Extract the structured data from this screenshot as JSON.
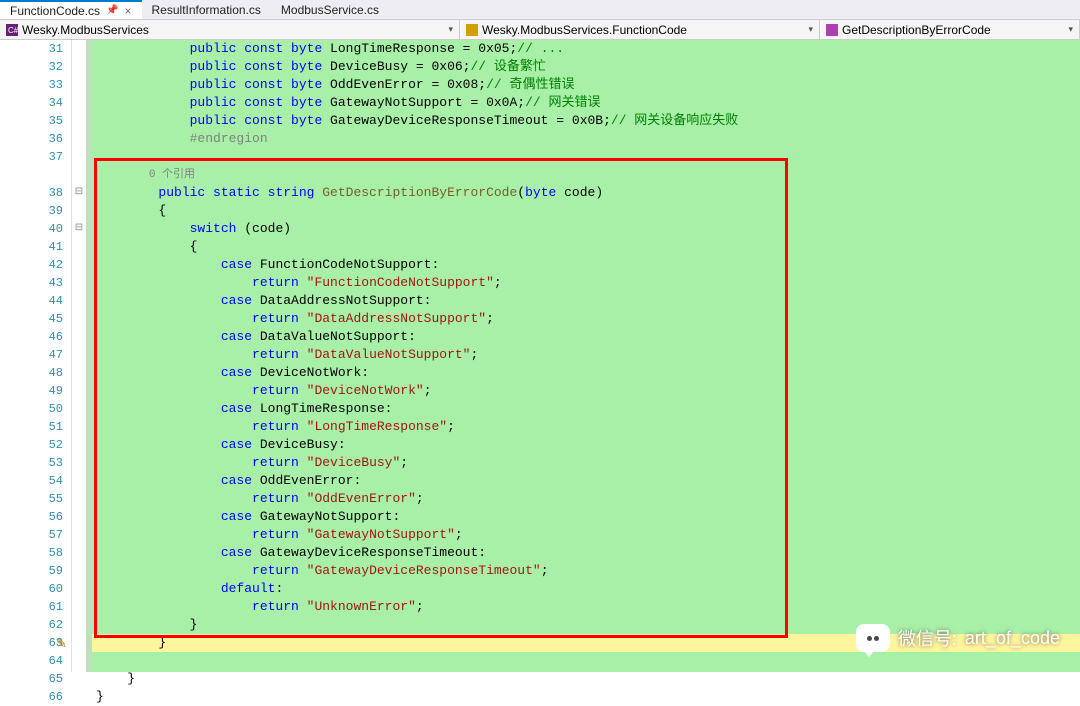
{
  "tabs": [
    {
      "label": "FunctionCode.cs",
      "active": true,
      "pinned": true
    },
    {
      "label": "ResultInformation.cs",
      "active": false,
      "pinned": false
    },
    {
      "label": "ModbusService.cs",
      "active": false,
      "pinned": false
    }
  ],
  "nav": {
    "project": "Wesky.ModbusServices",
    "namespace": "Wesky.ModbusServices.FunctionCode",
    "member": "GetDescriptionByErrorCode"
  },
  "line_start": 31,
  "line_end": 66,
  "pencil_line": 63,
  "yellow_line": 63,
  "ref_text": "0 个引用",
  "code": {
    "l32": {
      "prefix": "            ",
      "kw": "public const byte",
      "name": " DeviceBusy = 0x06;",
      "comment": "// 设备繁忙"
    },
    "l33": {
      "prefix": "            ",
      "kw": "public const byte",
      "name": " OddEvenError = 0x08;",
      "comment": "// 奇偶性错误"
    },
    "l34": {
      "prefix": "            ",
      "kw": "public const byte",
      "name": " GatewayNotSupport = 0x0A;",
      "comment": "// 网关错误"
    },
    "l35": {
      "prefix": "            ",
      "kw": "public const byte",
      "name": " GatewayDeviceResponseTimeout = 0x0B;",
      "comment": "// 网关设备响应失败"
    },
    "l36": {
      "text": "            #endregion"
    },
    "l38": {
      "indent": "        ",
      "mods": "public static string",
      "method": " GetDescriptionByErrorCode",
      "paren_open": "(",
      "ptype": "byte",
      "pname": " code",
      "paren_close": ")"
    },
    "l39": "        {",
    "l40_kw": "switch",
    "l40_rest": " (code)",
    "l41": "            {",
    "cases": [
      {
        "name": "FunctionCodeNotSupport",
        "ret": "\"FunctionCodeNotSupport\""
      },
      {
        "name": "DataAddressNotSupport",
        "ret": "\"DataAddressNotSupport\""
      },
      {
        "name": "DataValueNotSupport",
        "ret": "\"DataValueNotSupport\""
      },
      {
        "name": "DeviceNotWork",
        "ret": "\"DeviceNotWork\""
      },
      {
        "name": "LongTimeResponse",
        "ret": "\"LongTimeResponse\""
      },
      {
        "name": "DeviceBusy",
        "ret": "\"DeviceBusy\""
      },
      {
        "name": "OddEvenError",
        "ret": "\"OddEvenError\""
      },
      {
        "name": "GatewayNotSupport",
        "ret": "\"GatewayNotSupport\""
      },
      {
        "name": "GatewayDeviceResponseTimeout",
        "ret": "\"GatewayDeviceResponseTimeout\""
      }
    ],
    "default_kw": "default",
    "default_ret": "\"UnknownError\"",
    "l62": "            }",
    "l63": "        }",
    "l65": "    }",
    "l66": "}"
  },
  "watermark": {
    "prefix": "微信号:",
    "value": "art_of_code"
  },
  "colors": {
    "highlight_bg": "#a8f0a8",
    "red_box": "#ff0000"
  }
}
